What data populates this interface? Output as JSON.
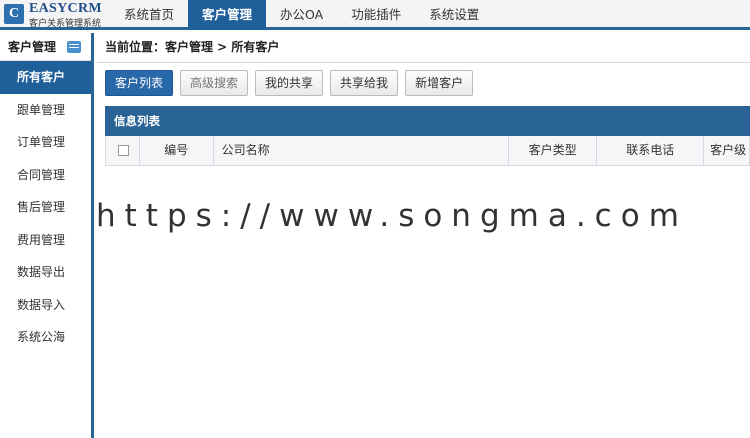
{
  "logo": {
    "mark": "C",
    "title": "EASYCRM",
    "subtitle": "客户关系管理系统"
  },
  "nav": [
    "系统首页",
    "客户管理",
    "办公OA",
    "功能插件",
    "系统设置"
  ],
  "sidebar": {
    "title": "客户管理",
    "items": [
      "所有客户",
      "跟单管理",
      "订单管理",
      "合同管理",
      "售后管理",
      "费用管理",
      "数据导出",
      "数据导入",
      "系统公海"
    ]
  },
  "breadcrumb": "当前位置：客户管理 > 所有客户",
  "toolbar": [
    "客户列表",
    "高级搜索",
    "我的共享",
    "共享给我",
    "新增客户"
  ],
  "panel": {
    "title": "信息列表"
  },
  "table": {
    "columns": [
      "编号",
      "公司名称",
      "客户类型",
      "联系电话",
      "客户级"
    ]
  },
  "watermark": "https://www.songma.com",
  "colors": {
    "primary": "#2a6496",
    "active": "#1f5f9a"
  }
}
